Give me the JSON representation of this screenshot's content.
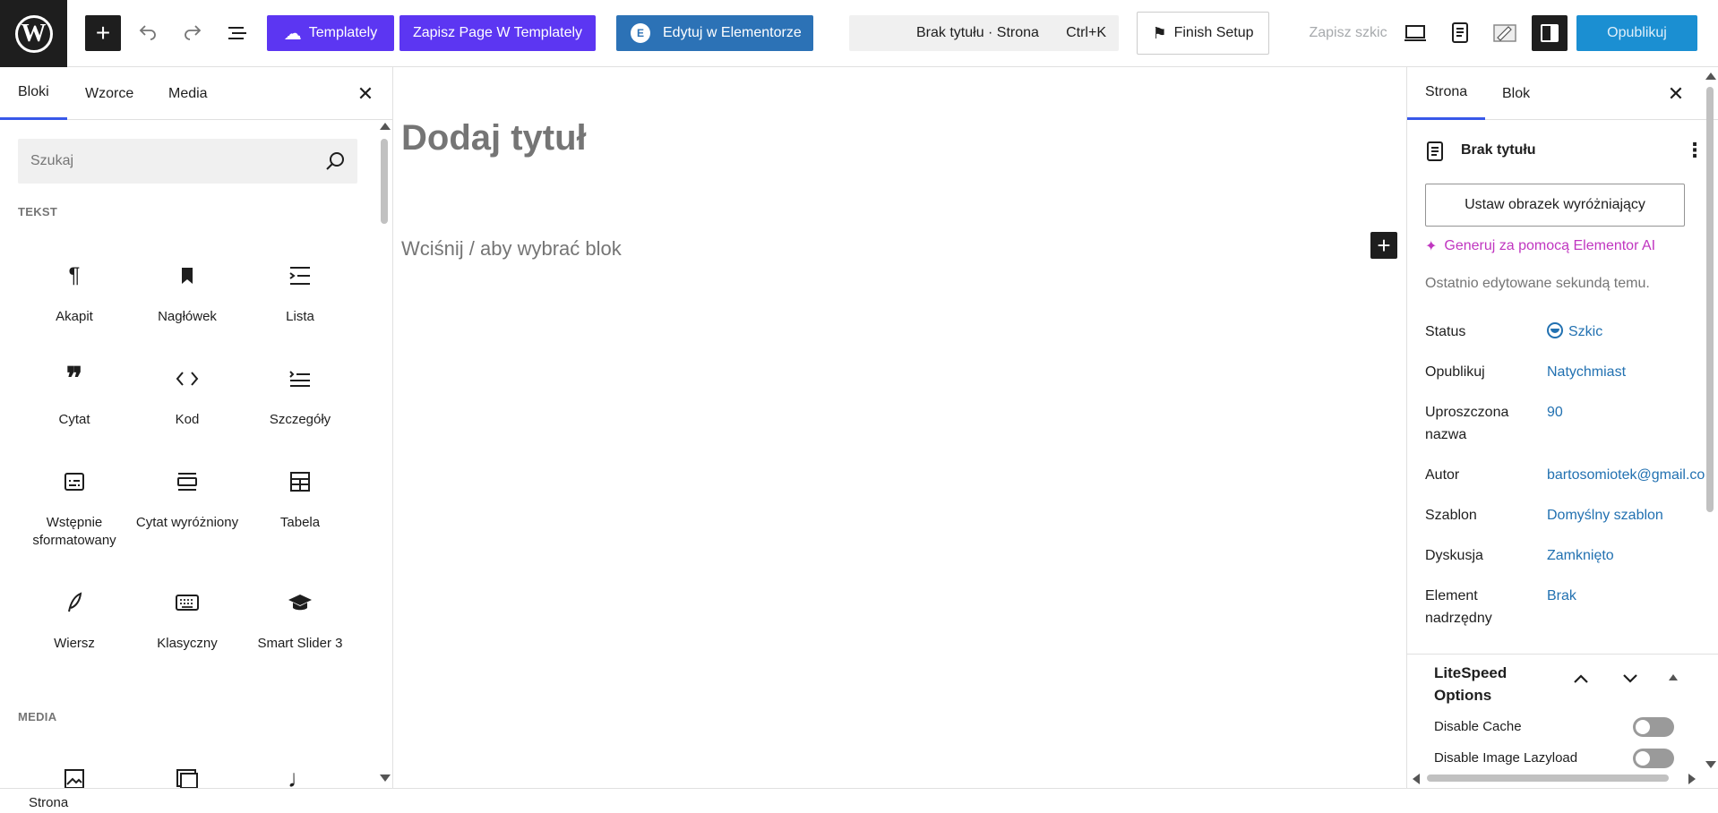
{
  "toolbar": {
    "templately_label": "Templately",
    "save_templately_label": "Zapisz Page W Templately",
    "elementor_label": "Edytuj w Elementorze",
    "doc_title": "Brak tytułu · Strona",
    "doc_shortcut": "Ctrl+K",
    "finish_setup_label": "Finish Setup",
    "save_draft_label": "Zapisz szkic",
    "publish_label": "Opublikuj",
    "accent_color": "#5c36f2",
    "elementor_color": "#2c72b6",
    "publish_color": "#1b8fd2"
  },
  "inserter": {
    "tabs": [
      "Bloki",
      "Wzorce",
      "Media"
    ],
    "active_tab": "Bloki",
    "search_placeholder": "Szukaj",
    "sections": {
      "text": "TEKST",
      "media": "MEDIA"
    },
    "blocks": [
      {
        "label": "Akapit",
        "icon": "paragraph-icon"
      },
      {
        "label": "Nagłówek",
        "icon": "heading-icon"
      },
      {
        "label": "Lista",
        "icon": "list-icon"
      },
      {
        "label": "Cytat",
        "icon": "quote-icon"
      },
      {
        "label": "Kod",
        "icon": "code-icon"
      },
      {
        "label": "Szczegóły",
        "icon": "details-icon"
      },
      {
        "label": "Wstępnie sformatowany",
        "icon": "preformatted-icon"
      },
      {
        "label": "Cytat wyróżniony",
        "icon": "pullquote-icon"
      },
      {
        "label": "Tabela",
        "icon": "table-icon"
      },
      {
        "label": "Wiersz",
        "icon": "verse-icon"
      },
      {
        "label": "Klasyczny",
        "icon": "keyboard-icon"
      },
      {
        "label": "Smart Slider 3",
        "icon": "graduation-cap-icon"
      }
    ]
  },
  "canvas": {
    "title_placeholder": "Dodaj tytuł",
    "block_placeholder": "Wciśnij / aby wybrać blok"
  },
  "sidebar": {
    "tabs": [
      "Strona",
      "Blok"
    ],
    "active_tab": "Strona",
    "doc_title": "Brak tytułu",
    "featured_image_label": "Ustaw obrazek wyróżniający",
    "ai_label": "Generuj za pomocą Elementor AI",
    "last_edited": "Ostatnio edytowane sekundą temu.",
    "fields": {
      "status": {
        "label": "Status",
        "value": "Szkic"
      },
      "publish": {
        "label": "Opublikuj",
        "value": "Natychmiast"
      },
      "slug": {
        "label_1": "Uproszczona",
        "label_2": "nazwa",
        "value": "90"
      },
      "author": {
        "label": "Autor",
        "value": "bartosomiotek@gmail.co"
      },
      "template": {
        "label": "Szablon",
        "value": "Domyślny szablon"
      },
      "discussion": {
        "label": "Dyskusja",
        "value": "Zamknięto"
      },
      "parent": {
        "label_1": "Element",
        "label_2": "nadrzędny",
        "value": "Brak"
      }
    },
    "litespeed": {
      "title_1": "LiteSpeed",
      "title_2": "Options",
      "options": [
        "Disable Cache",
        "Disable Image Lazyload"
      ]
    }
  },
  "footer": {
    "breadcrumb": "Strona"
  }
}
